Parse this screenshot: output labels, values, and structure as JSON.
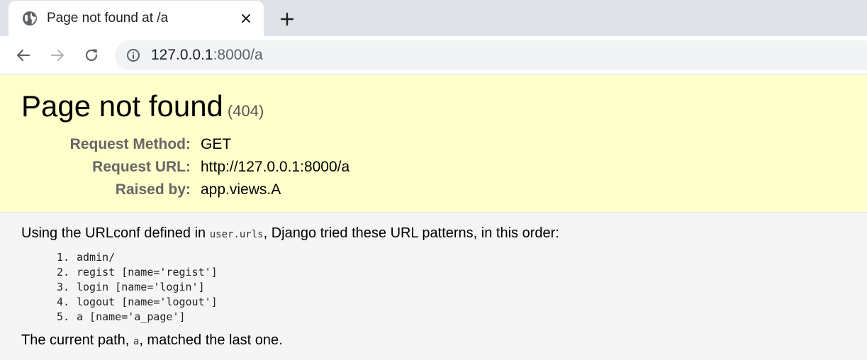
{
  "browser": {
    "tab_title": "Page not found at /a",
    "url_host": "127.0.0.1",
    "url_rest": ":8000/a"
  },
  "error": {
    "title": "Page not found",
    "code": "(404)",
    "meta": [
      {
        "label": "Request Method:",
        "value": "GET"
      },
      {
        "label": "Request URL:",
        "value": "http://127.0.0.1:8000/a"
      },
      {
        "label": "Raised by:",
        "value": "app.views.A"
      }
    ]
  },
  "info": {
    "intro_before": "Using the URLconf defined in ",
    "urlconf": "user.urls",
    "intro_after": ", Django tried these URL patterns, in this order:",
    "patterns": [
      {
        "num": "1.",
        "text": "admin/"
      },
      {
        "num": "2.",
        "text": "regist [name='regist']"
      },
      {
        "num": "3.",
        "text": "login [name='login']"
      },
      {
        "num": "4.",
        "text": "logout [name='logout']"
      },
      {
        "num": "5.",
        "text": "a [name='a_page']"
      }
    ],
    "current_before": "The current path, ",
    "current_path": "a",
    "current_after": ", matched the last one."
  }
}
